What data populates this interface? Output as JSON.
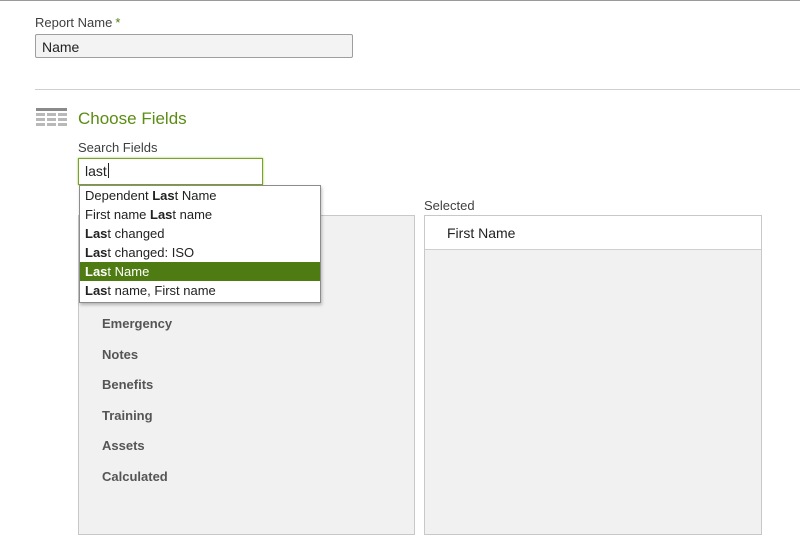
{
  "report": {
    "label": "Report Name",
    "required_marker": "*",
    "value": "Name"
  },
  "section": {
    "title": "Choose Fields",
    "icon": "table-grid-icon"
  },
  "search": {
    "label": "Search Fields",
    "value": "last"
  },
  "dropdown": {
    "items": [
      {
        "pre": "Dependent ",
        "match": "Last",
        "post": " Name",
        "highlighted": false
      },
      {
        "pre": "First name ",
        "match": "Last",
        "post": " name",
        "highlighted": false
      },
      {
        "pre": "",
        "match": "Last",
        "post": " changed",
        "highlighted": false
      },
      {
        "pre": "",
        "match": "Last",
        "post": " changed: ISO",
        "highlighted": false
      },
      {
        "pre": "",
        "match": "Last",
        "post": " Name",
        "highlighted": true
      },
      {
        "pre": "",
        "match": "Last",
        "post": " name, First name",
        "highlighted": false
      }
    ]
  },
  "categories": {
    "items": [
      "Emergency",
      "Notes",
      "Benefits",
      "Training",
      "Assets",
      "Calculated"
    ]
  },
  "selected": {
    "label": "Selected",
    "items": [
      "First Name"
    ]
  },
  "colors": {
    "accent_green": "#5b8c14",
    "highlight_green": "#4f7c12"
  }
}
